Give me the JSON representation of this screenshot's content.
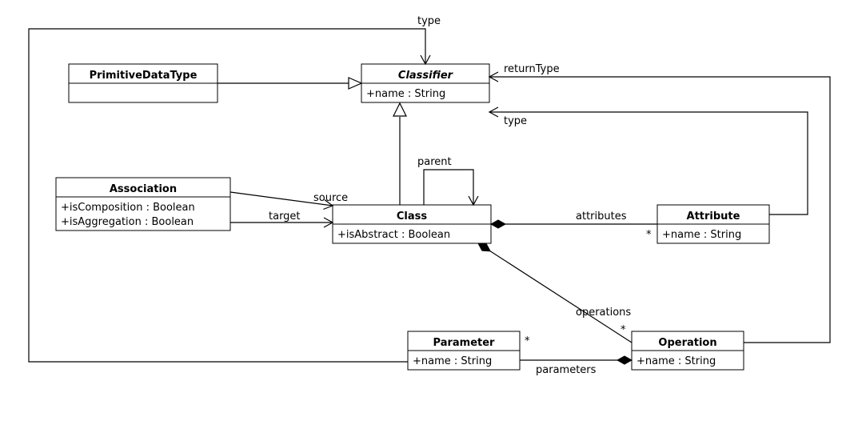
{
  "chart_data": {
    "type": "uml-class-diagram",
    "classes": [
      {
        "id": "Classifier",
        "name": "Classifier",
        "abstract": true,
        "attributes": [
          "+name : String"
        ]
      },
      {
        "id": "PrimitiveDataType",
        "name": "PrimitiveDataType",
        "abstract": false,
        "attributes": []
      },
      {
        "id": "Association",
        "name": "Association",
        "abstract": false,
        "attributes": [
          "+isComposition : Boolean",
          "+isAggregation : Boolean"
        ]
      },
      {
        "id": "Class",
        "name": "Class",
        "abstract": false,
        "attributes": [
          "+isAbstract : Boolean"
        ]
      },
      {
        "id": "Attribute",
        "name": "Attribute",
        "abstract": false,
        "attributes": [
          "+name : String"
        ]
      },
      {
        "id": "Operation",
        "name": "Operation",
        "abstract": false,
        "attributes": [
          "+name : String"
        ]
      },
      {
        "id": "Parameter",
        "name": "Parameter",
        "abstract": false,
        "attributes": [
          "+name : String"
        ]
      }
    ],
    "relations": [
      {
        "type": "generalization",
        "from": "PrimitiveDataType",
        "to": "Classifier"
      },
      {
        "type": "generalization",
        "from": "Class",
        "to": "Classifier"
      },
      {
        "type": "association",
        "from": "Association",
        "to": "Class",
        "label": "source",
        "arrow": "open"
      },
      {
        "type": "association",
        "from": "Association",
        "to": "Class",
        "label": "target",
        "arrow": "open"
      },
      {
        "type": "association-self",
        "from": "Class",
        "to": "Class",
        "label": "parent",
        "arrow": "open"
      },
      {
        "type": "composition",
        "from": "Class",
        "to": "Attribute",
        "label": "attributes",
        "multiplicity": "*"
      },
      {
        "type": "composition",
        "from": "Class",
        "to": "Operation",
        "label": "operations",
        "multiplicity": "*"
      },
      {
        "type": "composition",
        "from": "Operation",
        "to": "Parameter",
        "label": "parameters",
        "multiplicity": "*"
      },
      {
        "type": "association",
        "from": "Attribute",
        "to": "Classifier",
        "label": "type",
        "arrow": "open"
      },
      {
        "type": "association",
        "from": "Operation",
        "to": "Classifier",
        "label": "returnType",
        "arrow": "open"
      },
      {
        "type": "association",
        "from": "Parameter",
        "to": "Classifier",
        "label": "type",
        "arrow": "open"
      }
    ]
  },
  "boxes": {
    "classifier": {
      "title": "Classifier",
      "attrs": [
        "+name : String"
      ]
    },
    "primitiveDataType": {
      "title": "PrimitiveDataType",
      "attrs": []
    },
    "association": {
      "title": "Association",
      "attrs": [
        "+isComposition : Boolean",
        "+isAggregation : Boolean"
      ]
    },
    "class": {
      "title": "Class",
      "attrs": [
        "+isAbstract : Boolean"
      ]
    },
    "attribute": {
      "title": "Attribute",
      "attrs": [
        "+name : String"
      ]
    },
    "operation": {
      "title": "Operation",
      "attrs": [
        "+name : String"
      ]
    },
    "parameter": {
      "title": "Parameter",
      "attrs": [
        "+name : String"
      ]
    }
  },
  "labels": {
    "type_top": "type",
    "returnType": "returnType",
    "type_attr": "type",
    "parent": "parent",
    "source": "source",
    "target": "target",
    "attributes": "attributes",
    "attributes_mult": "*",
    "operations": "operations",
    "operations_mult": "*",
    "parameters": "parameters",
    "parameters_mult": "*"
  }
}
